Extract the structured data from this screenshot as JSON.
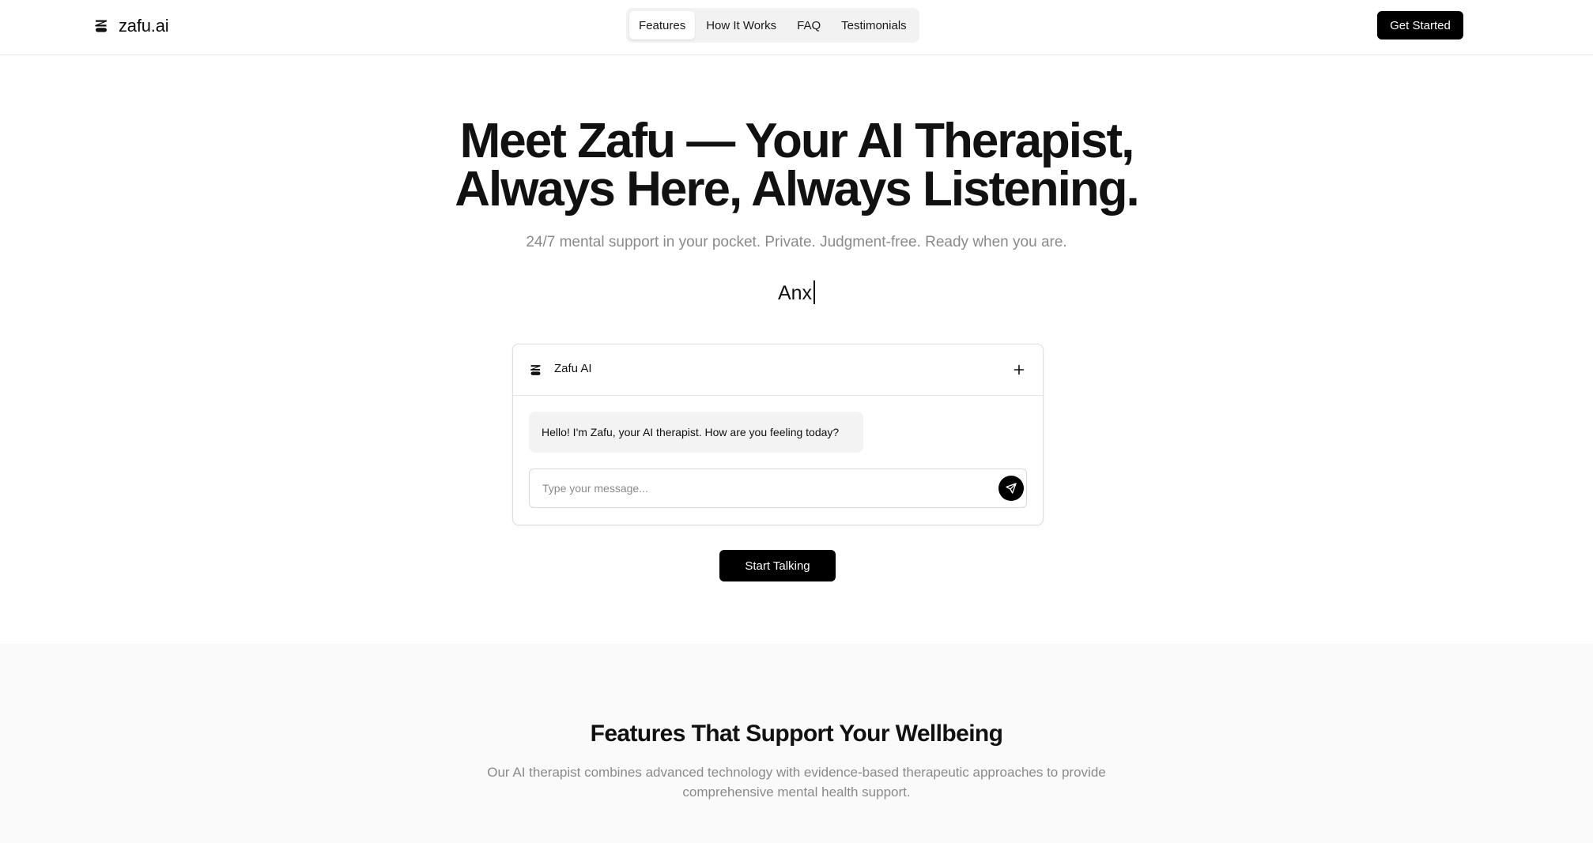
{
  "header": {
    "brand": "zafu.ai",
    "brand_icon": "zafu-logo-icon",
    "nav": [
      {
        "label": "Features",
        "active": true
      },
      {
        "label": "How It Works",
        "active": false
      },
      {
        "label": "FAQ",
        "active": false
      },
      {
        "label": "Testimonials",
        "active": false
      }
    ],
    "cta_label": "Get Started"
  },
  "hero": {
    "title_line1": "Meet Zafu — Your AI Therapist,",
    "title_line2": "Always Here, Always Listening.",
    "subtitle": "24/7 mental support in your pocket. Private. Judgment-free. Ready when you are.",
    "typing_text": "Anx"
  },
  "chat": {
    "title": "Zafu AI",
    "logo_icon": "zafu-logo-icon",
    "new_chat_icon": "plus-icon",
    "bot_message": "Hello! I'm Zafu, your AI therapist. How are you feeling today?",
    "input_placeholder": "Type your message...",
    "input_value": "",
    "send_icon": "send-icon"
  },
  "cta": {
    "start_label": "Start Talking"
  },
  "features": {
    "title": "Features That Support Your Wellbeing",
    "description": "Our AI therapist combines advanced technology with evidence-based therapeutic approaches to provide comprehensive mental health support."
  },
  "colors": {
    "primary": "#000000",
    "text": "#111111",
    "muted": "#8a8a8a",
    "border": "#e5e5e5",
    "section_bg": "#fafafa",
    "bubble_bg": "#f3f3f3"
  }
}
